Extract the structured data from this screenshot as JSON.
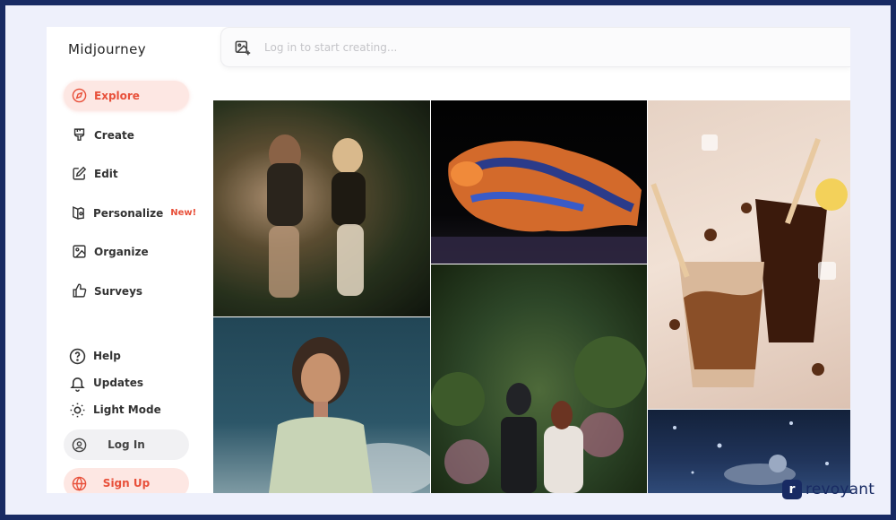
{
  "sidebar": {
    "app_title": "Midjourney",
    "nav": [
      {
        "label": "Explore",
        "icon": "compass-icon",
        "active": true
      },
      {
        "label": "Create",
        "icon": "brush-icon"
      },
      {
        "label": "Edit",
        "icon": "edit-icon"
      },
      {
        "label": "Personalize",
        "icon": "personalize-icon",
        "badge": "New!"
      },
      {
        "label": "Organize",
        "icon": "image-icon"
      },
      {
        "label": "Surveys",
        "icon": "thumbs-up-icon"
      }
    ],
    "utilities": [
      {
        "label": "Help",
        "icon": "help-circle-icon"
      },
      {
        "label": "Updates",
        "icon": "bell-icon"
      },
      {
        "label": "Light Mode",
        "icon": "sun-icon"
      }
    ],
    "login_label": "Log In",
    "signup_label": "Sign Up"
  },
  "search": {
    "placeholder": "Log in to start creating..."
  },
  "gallery": {
    "tiles": [
      {
        "subject": "runners"
      },
      {
        "subject": "tiger"
      },
      {
        "subject": "iced-coffee"
      },
      {
        "subject": "portrait"
      },
      {
        "subject": "knight-garden"
      },
      {
        "subject": "snow-scene"
      }
    ]
  },
  "watermark": {
    "mark": "r",
    "text": "revoyant"
  },
  "colors": {
    "accent": "#e8503a",
    "accent_bg": "#fde7e3",
    "frame": "#182a63"
  }
}
